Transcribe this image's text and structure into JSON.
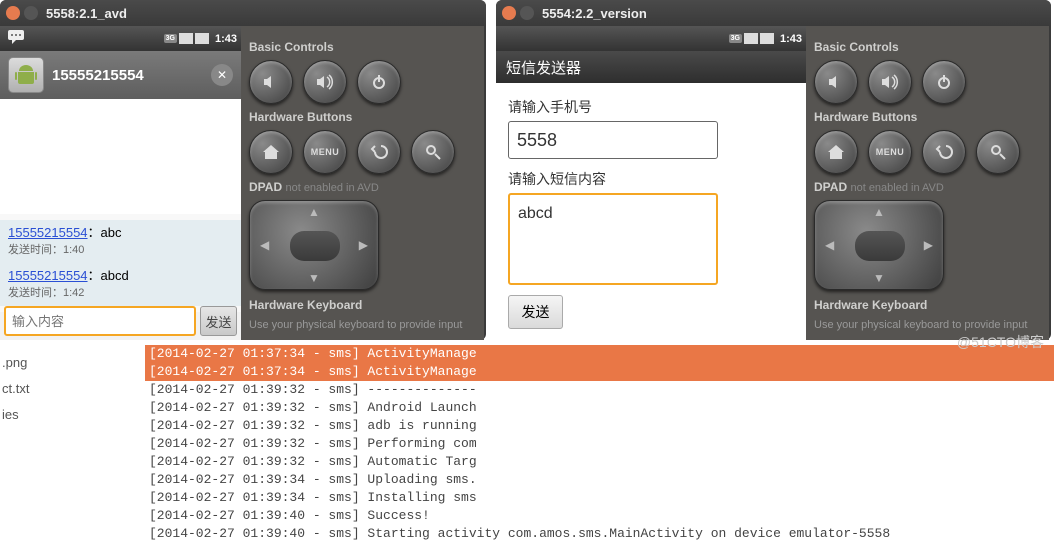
{
  "watermark": "@51CTO博客",
  "bg_files": {
    "f1": ".png",
    "f2": "ct.txt",
    "f3": "ies"
  },
  "emu1": {
    "title": "5558:2.1_avd",
    "status_time": "1:43",
    "status_3g": "3G",
    "notif_title": "15555215554",
    "sms": [
      {
        "from": "15555215554",
        "sep": "：",
        "body": "abc",
        "time_label": "发送时间：",
        "time": "1:40"
      },
      {
        "from": "15555215554",
        "sep": "：",
        "body": "abcd",
        "time_label": "发送时间：",
        "time": "1:42"
      }
    ],
    "compose_placeholder": "输入内容",
    "compose_send": "发送"
  },
  "emu2": {
    "title": "5554:2.2_version",
    "status_time": "1:43",
    "status_3g": "3G",
    "app_title": "短信发送器",
    "label_phone": "请输入手机号",
    "value_phone": "5558",
    "label_content": "请输入短信内容",
    "value_content": "abcd",
    "btn_send": "发送"
  },
  "side": {
    "basic": "Basic Controls",
    "hw": "Hardware Buttons",
    "menu": "MENU",
    "dpad": "DPAD",
    "dpad_note": "not enabled in AVD",
    "kbd": "Hardware Keyboard",
    "kbd_note": "Use your physical keyboard to provide input"
  },
  "console": [
    {
      "hl": true,
      "t": "[2014-02-27 01:37:34 - sms] ActivityManage"
    },
    {
      "hl": true,
      "t": "[2014-02-27 01:37:34 - sms] ActivityManage"
    },
    {
      "hl": false,
      "t": "[2014-02-27 01:39:32 - sms] --------------"
    },
    {
      "hl": false,
      "t": "[2014-02-27 01:39:32 - sms] Android Launch"
    },
    {
      "hl": false,
      "t": "[2014-02-27 01:39:32 - sms] adb is running"
    },
    {
      "hl": false,
      "t": "[2014-02-27 01:39:32 - sms] Performing com"
    },
    {
      "hl": false,
      "t": "[2014-02-27 01:39:32 - sms] Automatic Targ"
    },
    {
      "hl": false,
      "t": "[2014-02-27 01:39:34 - sms] Uploading sms."
    },
    {
      "hl": false,
      "t": "[2014-02-27 01:39:34 - sms] Installing sms"
    },
    {
      "hl": false,
      "t": "[2014-02-27 01:39:40 - sms] Success!"
    },
    {
      "hl": false,
      "t": "[2014-02-27 01:39:40 - sms] Starting activity com.amos.sms.MainActivity on device emulator-5558"
    }
  ]
}
